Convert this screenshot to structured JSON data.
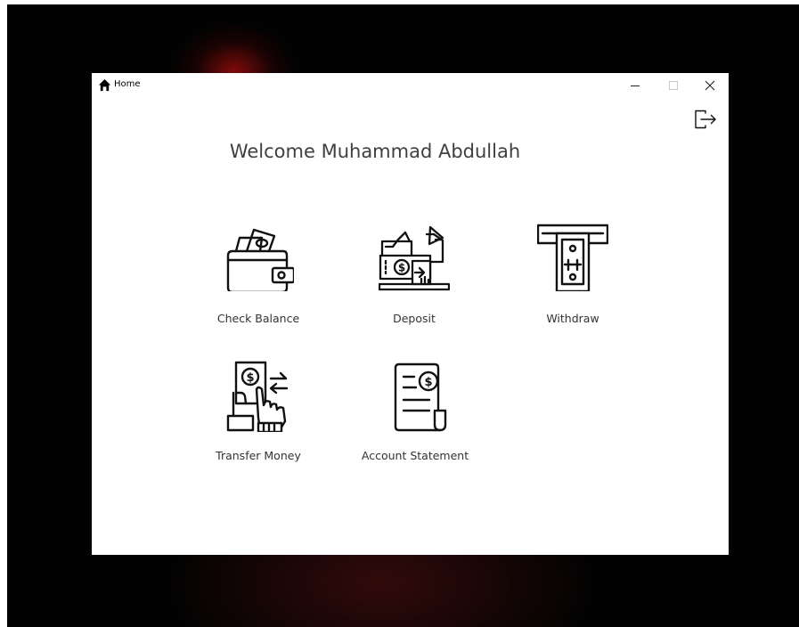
{
  "window": {
    "title": "Home",
    "icons": {
      "title": "home-icon",
      "minimize": "minimize-icon",
      "maximize": "maximize-icon",
      "close": "close-icon",
      "logout": "logout-icon"
    }
  },
  "main": {
    "welcome": "Welcome Muhammad Abdullah",
    "tiles": [
      {
        "label": "Check Balance",
        "icon": "wallet-icon"
      },
      {
        "label": "Deposit",
        "icon": "deposit-icon"
      },
      {
        "label": "Withdraw",
        "icon": "atm-withdraw-icon"
      },
      {
        "label": "Transfer Money",
        "icon": "transfer-money-icon"
      },
      {
        "label": "Account Statement",
        "icon": "statement-icon"
      }
    ]
  },
  "colors": {
    "background": "#020202",
    "window": "#ffffff",
    "text": "#333333",
    "accent_dark": "#960c0c"
  }
}
